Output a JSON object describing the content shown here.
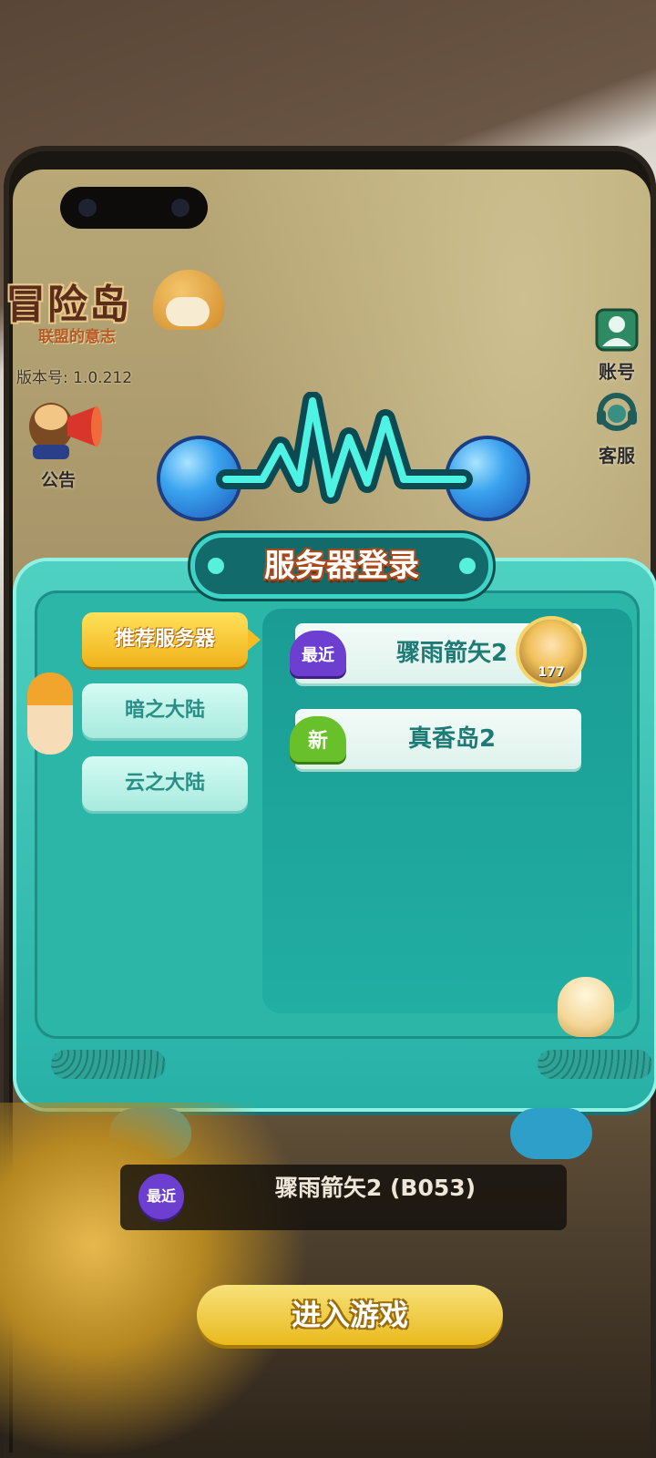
{
  "game": {
    "logo_title": "冒险岛",
    "logo_subtitle": "联盟的意志",
    "version": "版本号: 1.0.212"
  },
  "side_buttons": {
    "notice_label": "公告",
    "account_label": "账号",
    "service_label": "客服"
  },
  "dialog": {
    "title": "服务器登录",
    "tabs": [
      {
        "label": "推荐服务器",
        "active": true
      },
      {
        "label": "暗之大陆",
        "active": false
      },
      {
        "label": "云之大陆",
        "active": false
      }
    ],
    "servers": [
      {
        "badge": "最近",
        "name": "骤雨箭矢2",
        "avatar_level": "177"
      },
      {
        "badge": "新",
        "name": "真香岛2"
      }
    ]
  },
  "current_server": {
    "badge": "最近",
    "name": "骤雨箭矢2 (B053)"
  },
  "enter_button": "进入游戏",
  "colors": {
    "panel_teal": "#27b1a6",
    "tab_active_yellow": "#f0b21b",
    "badge_recent_purple": "#6c3fd1",
    "badge_new_green": "#68c12a",
    "title_outline_orange": "#a84a1c"
  }
}
